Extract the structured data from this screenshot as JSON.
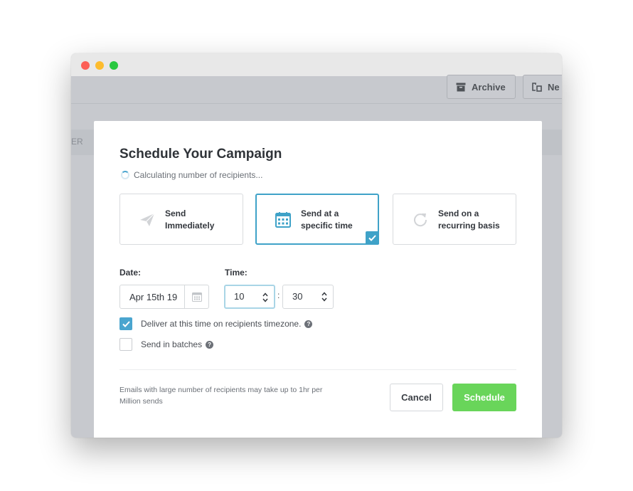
{
  "background": {
    "toolbar": {
      "archive_label": "Archive",
      "new_label": "Ne"
    },
    "column_header_fragment": "ER"
  },
  "modal": {
    "title": "Schedule Your Campaign",
    "status": "Calculating number of recipients...",
    "options": [
      {
        "label": "Send\nImmediately",
        "icon": "paper-plane-icon",
        "selected": false
      },
      {
        "label": "Send at a\nspecific time",
        "icon": "calendar-icon",
        "selected": true
      },
      {
        "label": "Send on a\nrecurring basis",
        "icon": "refresh-icon",
        "selected": false
      }
    ],
    "date": {
      "label": "Date:",
      "value": "Apr 15th 19"
    },
    "time": {
      "label": "Time:",
      "hour": "10",
      "minute": "30",
      "separator": ":"
    },
    "checkboxes": [
      {
        "label": "Deliver at this time on recipients timezone.",
        "checked": true
      },
      {
        "label": "Send in batches",
        "checked": false
      }
    ],
    "footnote": "Emails with large number of recipients may take up to 1hr per Million sends",
    "buttons": {
      "cancel": "Cancel",
      "schedule": "Schedule"
    }
  },
  "colors": {
    "accent": "#3fa2c8",
    "checkbox": "#4aa5cf",
    "schedule_button": "#69d55a",
    "overlay": "#c7c9ce"
  }
}
